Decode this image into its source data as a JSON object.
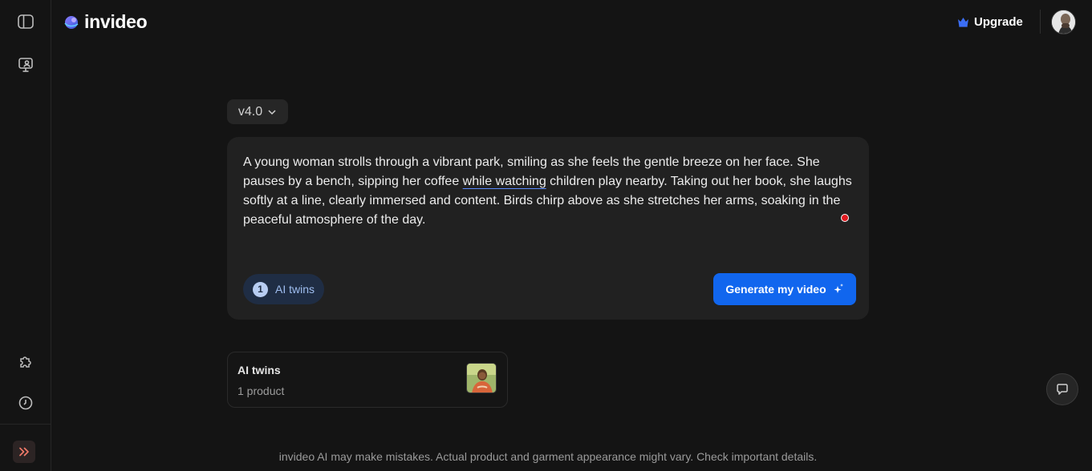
{
  "app": {
    "logo_text": "invideo"
  },
  "header": {
    "upgrade_label": "Upgrade"
  },
  "composer": {
    "version_label": "v4.0",
    "prompt_before": "A young woman strolls through a vibrant park, smiling as she feels the gentle breeze on her face. She pauses by a bench, sipping her coffee ",
    "prompt_underlined": "while watching",
    "prompt_after": " children play nearby. Taking out her book, she laughs softly at a line, clearly immersed and content. Birds chirp above as she stretches her arms, soaking in the peaceful atmosphere of the day.",
    "twins_count": "1",
    "twins_label": "AI twins",
    "generate_label": "Generate my video"
  },
  "twins_card": {
    "title": "AI twins",
    "subtitle": "1 product"
  },
  "footer": {
    "disclaimer": "invideo AI may make mistakes. Actual product and garment appearance might vary. Check important details."
  },
  "icons": {
    "sidebar": [
      "sidebar-toggle-icon",
      "presentation-icon",
      "puzzle-icon",
      "clock-icon",
      "chevrons-right-icon"
    ],
    "upgrade": "crown-icon",
    "generate": "sparkle-icon",
    "chat": "chat-bubble-icon"
  },
  "colors": {
    "accent": "#1166ee",
    "upgrade_icon": "#3b6ef5",
    "background": "#141414",
    "card": "#212121",
    "record": "#e0191f"
  }
}
